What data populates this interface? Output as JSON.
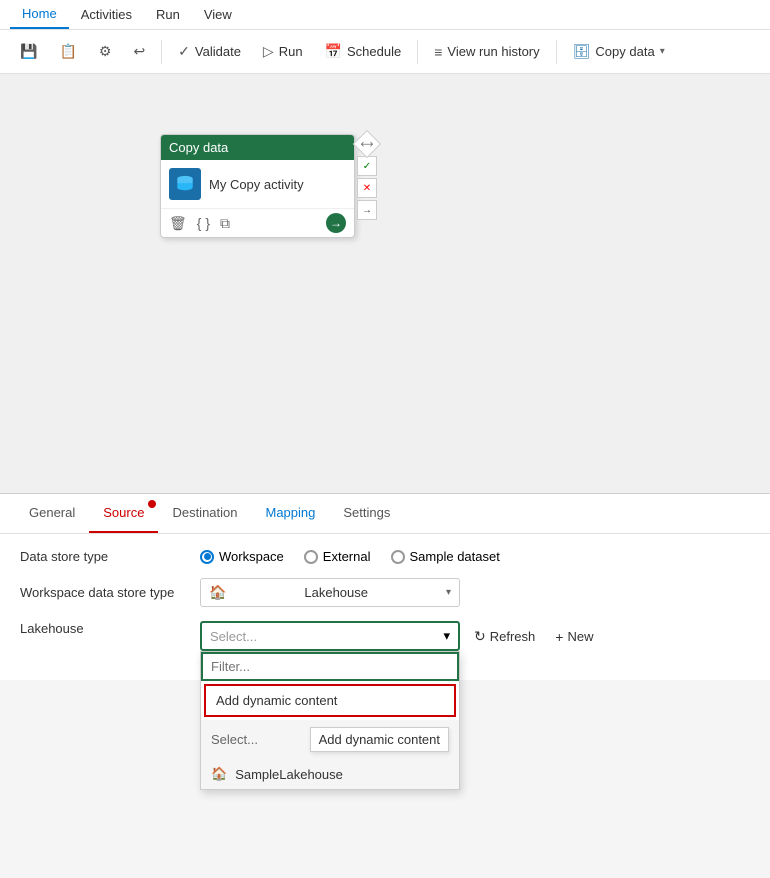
{
  "menuBar": {
    "items": [
      {
        "label": "Home",
        "active": true
      },
      {
        "label": "Activities",
        "active": false
      },
      {
        "label": "Run",
        "active": false
      },
      {
        "label": "View",
        "active": false
      }
    ]
  },
  "toolbar": {
    "save_icon": "💾",
    "copy_icon": "📋",
    "settings_icon": "⚙",
    "undo_icon": "↩",
    "validate_label": "Validate",
    "run_label": "Run",
    "schedule_label": "Schedule",
    "view_run_history_label": "View run history",
    "copy_data_label": "Copy data"
  },
  "canvas": {
    "activity": {
      "title": "Copy data",
      "name": "My Copy activity",
      "icon": "🗄"
    }
  },
  "tabs": {
    "items": [
      {
        "label": "General",
        "active": false
      },
      {
        "label": "Source",
        "active": true,
        "badge": true
      },
      {
        "label": "Destination",
        "active": false
      },
      {
        "label": "Mapping",
        "active": false
      },
      {
        "label": "Settings",
        "active": false
      }
    ]
  },
  "form": {
    "dataStoreTypeLabel": "Data store type",
    "workspaceDataStoreTypeLabel": "Workspace data store type",
    "lakehouseLabel": "Lakehouse",
    "radioOptions": [
      {
        "label": "Workspace",
        "checked": true
      },
      {
        "label": "External",
        "checked": false
      },
      {
        "label": "Sample dataset",
        "checked": false
      }
    ],
    "workspaceDataStoreType": "Lakehouse",
    "lakehousePlaceholder": "Select...",
    "filterPlaceholder": "Filter...",
    "addDynamicContent": "Add dynamic content",
    "selectOption": "Select...",
    "addDynamicContentTooltip": "Add dynamic content",
    "sampleLakehouseLabel": "SampleLakehouse",
    "refreshLabel": "Refresh",
    "newLabel": "New"
  }
}
